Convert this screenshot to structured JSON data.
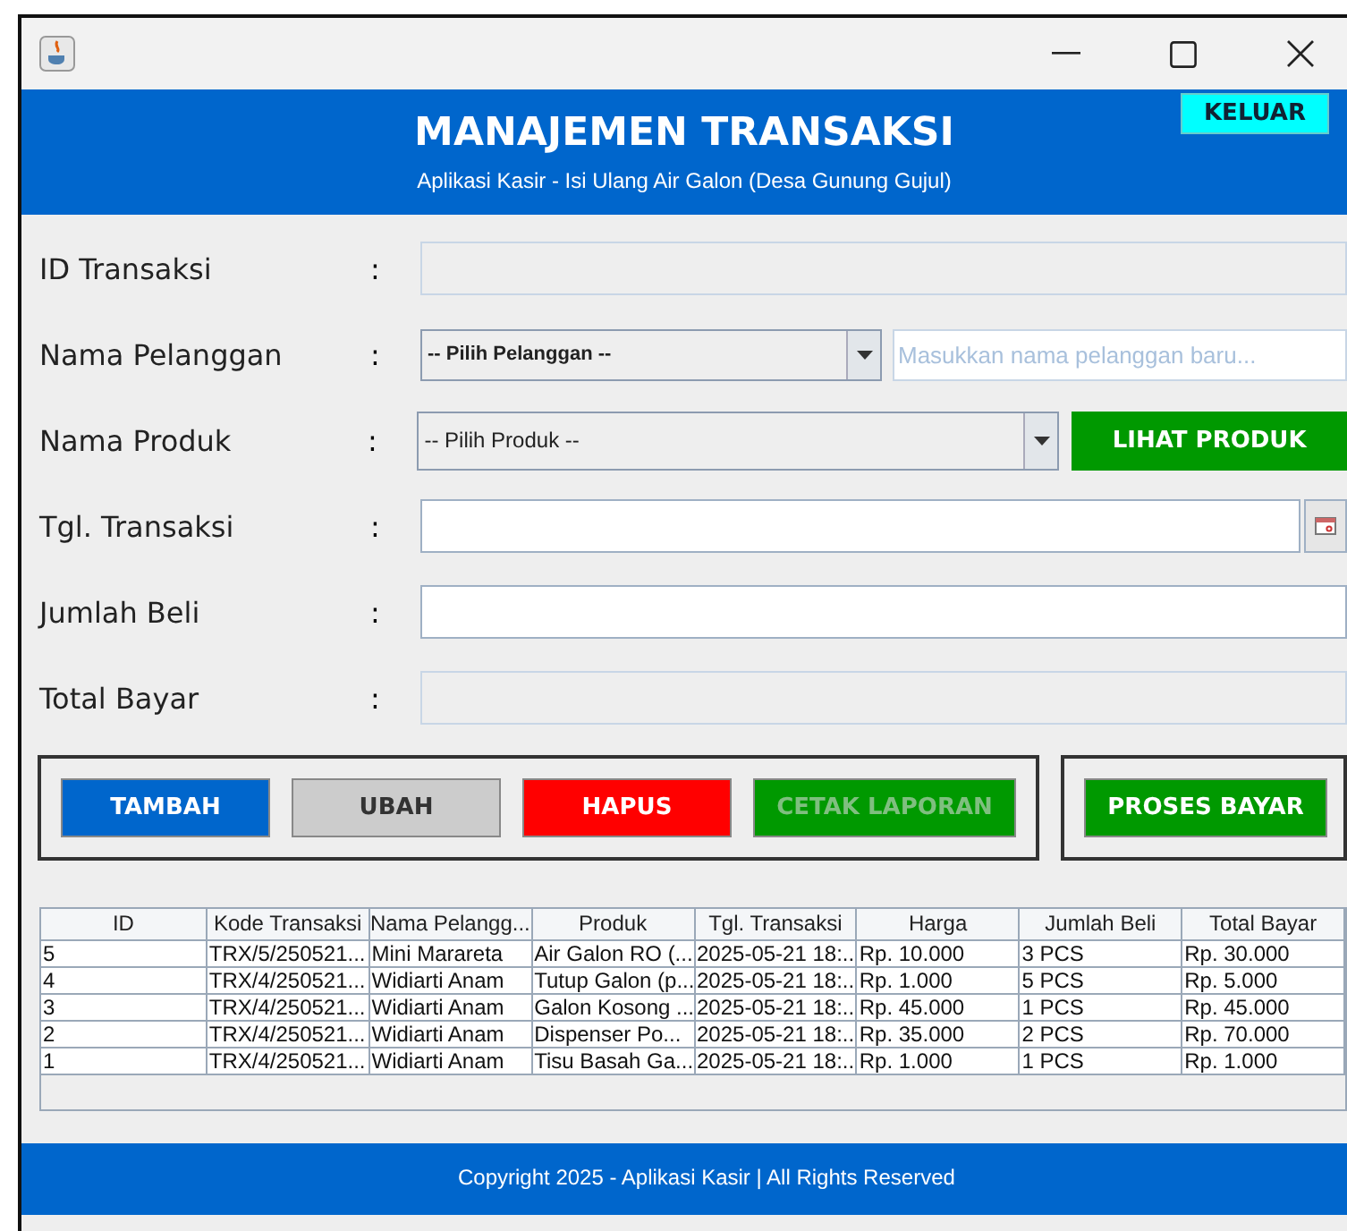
{
  "header": {
    "title": "MANAJEMEN TRANSAKSI",
    "subtitle": "Aplikasi Kasir - Isi Ulang Air Galon (Desa Gunung Gujul)",
    "exit_button": "KELUAR"
  },
  "form": [
    {
      "label": "ID Transaksi",
      "colon": ":",
      "kind": "text",
      "disabled": true
    },
    {
      "label": "Nama Pelanggan",
      "colon": ":",
      "kind": "combo-input",
      "value": "-- Pilih Pelanggan --",
      "placeholder": "Masukkan nama pelanggan baru..."
    },
    {
      "label": "Nama Produk",
      "colon": ":",
      "kind": "combo-button",
      "value": "-- Pilih Produk --",
      "button": "LIHAT PRODUK"
    },
    {
      "label": "Tgl. Transaksi",
      "colon": ":",
      "kind": "date",
      "disabled": false
    },
    {
      "label": "Jumlah Beli",
      "colon": ":",
      "kind": "text",
      "disabled": false
    },
    {
      "label": "Total Bayar",
      "colon": ":",
      "kind": "text",
      "disabled": true
    }
  ],
  "actions": [
    {
      "label": "TAMBAH",
      "color": "#0066cc",
      "disabled": false
    },
    {
      "label": "UBAH",
      "color": "#cccccc",
      "disabled": false
    },
    {
      "label": "HAPUS",
      "color": "#ff0000",
      "disabled": false
    },
    {
      "label": "CETAK LAPORAN",
      "color": "#009900",
      "disabled": true
    }
  ],
  "pay_button": {
    "label": "PROSES BAYAR",
    "color": "#009900"
  },
  "table": {
    "columns": [
      "ID",
      "Kode Transaksi",
      "Nama Pelangg...",
      "Produk",
      "Tgl. Transaksi",
      "Harga",
      "Jumlah Beli",
      "Total Bayar"
    ],
    "rows": [
      [
        "5",
        "TRX/5/250521...",
        "Mini Marareta",
        "Air Galon RO (...",
        "2025-05-21 18:...",
        "Rp. 10.000",
        "3 PCS",
        "Rp. 30.000"
      ],
      [
        "4",
        "TRX/4/250521...",
        "Widiarti Anam",
        "Tutup Galon (p...",
        "2025-05-21 18:...",
        "Rp. 1.000",
        "5 PCS",
        "Rp. 5.000"
      ],
      [
        "3",
        "TRX/4/250521...",
        "Widiarti Anam",
        "Galon Kosong ...",
        "2025-05-21 18:...",
        "Rp. 45.000",
        "1 PCS",
        "Rp. 45.000"
      ],
      [
        "2",
        "TRX/4/250521...",
        "Widiarti Anam",
        "Dispenser Po...",
        "2025-05-21 18:...",
        "Rp. 35.000",
        "2 PCS",
        "Rp. 70.000"
      ],
      [
        "1",
        "TRX/4/250521...",
        "Widiarti Anam",
        "Tisu Basah Ga...",
        "2025-05-21 18:...",
        "Rp. 1.000",
        "1 PCS",
        "Rp. 1.000"
      ]
    ]
  },
  "footer": "Copyright 2025 - Aplikasi Kasir | All Rights Reserved"
}
